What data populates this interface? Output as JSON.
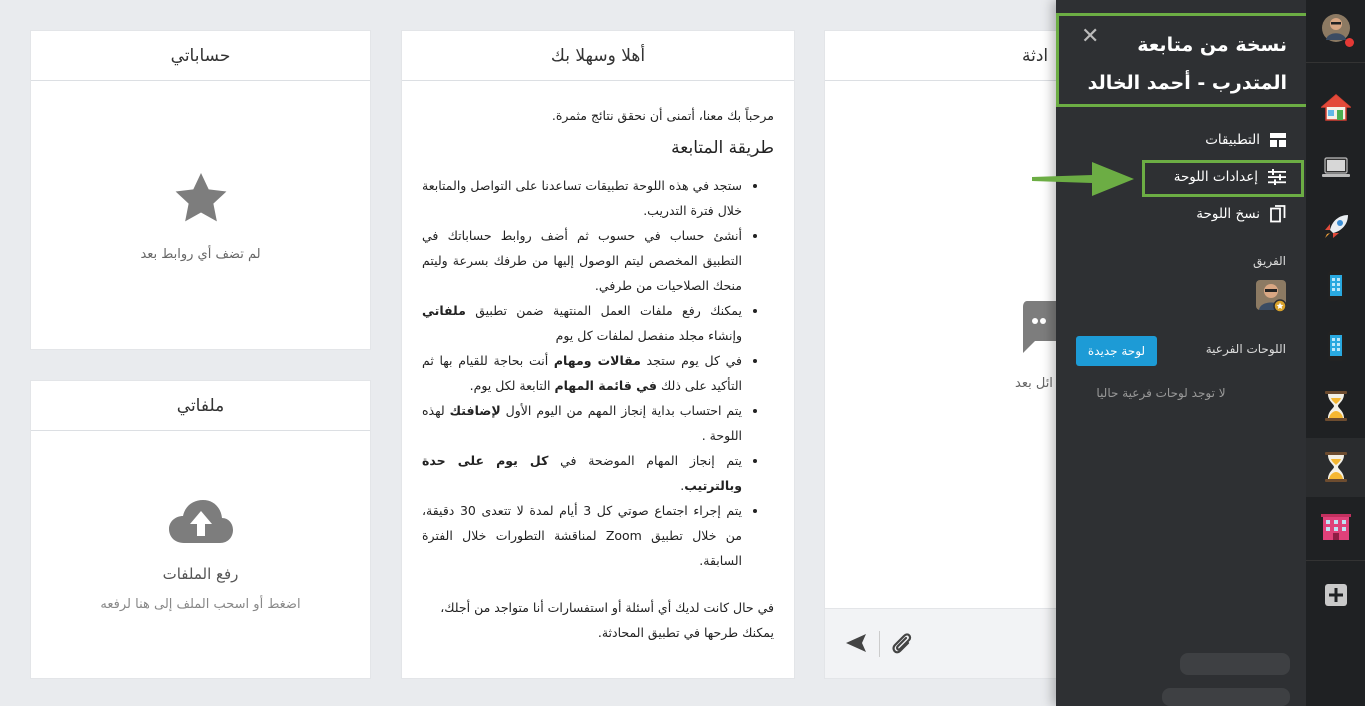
{
  "accounts_card": {
    "title": "حساباتي",
    "empty_text": "لم تضف أي روابط بعد"
  },
  "files_card": {
    "title": "ملفاتي",
    "upload_title": "رفع الملفات",
    "upload_hint": "اضغط أو اسحب الملف إلى هنا لرفعه"
  },
  "welcome_card": {
    "title": "أهلا وسهلا بك",
    "intro": "مرحباً بك معنا، أتمنى أن نحقق نتائج مثمرة.",
    "heading": "طريقة المتابعة",
    "items": [
      {
        "text": "ستجد في هذه اللوحة تطبيقات تساعدنا على التواصل والمتابعة خلال فترة التدريب."
      },
      {
        "text": "أنشئ حساب في حسوب ثم أضف روابط حساباتك في التطبيق المخصص ليتم الوصول إليها من طرفك بسرعة وليتم منحك الصلاحيات من طرفي."
      },
      {
        "pre": "يمكنك رفع ملفات العمل المنتهية ضمن تطبيق ",
        "bold": "ملفاتي",
        "post": " وإنشاء مجلد منفصل لملفات كل يوم"
      },
      {
        "pre": "في كل يوم ستجد ",
        "bold": "مقالات ومهام",
        "mid": " أنت بحاجة للقيام بها ثم التأكيد على ذلك ",
        "bold2": "في قائمة المهام",
        "post": " التابعة لكل يوم."
      },
      {
        "pre": "يتم احتساب بداية إنجاز المهم من اليوم الأول ",
        "bold": "لإضافتك",
        "post": " لهذه اللوحة ."
      },
      {
        "pre": "يتم إنجاز المهام الموضحة في ",
        "bold": "كل يوم على حدة وبالترتيب",
        "post": "."
      },
      {
        "text": "يتم إجراء اجتماع صوتي كل 3 أيام لمدة لا تتعدى 30 دقيقة، من خلال تطبيق Zoom لمناقشة التطورات خلال الفترة السابقة."
      }
    ],
    "outro": "في حال كانت لديك أي أسئلة أو استفسارات أنا متواجد من أجلك، يمكنك طرحها في تطبيق المحادثة."
  },
  "chat_card": {
    "title_partial": "ادثة",
    "empty_partial": "ائل بعد"
  },
  "side_panel": {
    "title_line1": "نسخة من متابعة",
    "title_line2": "المتدرب - أحمد الخالد",
    "close_icon": "close-icon",
    "menu": {
      "apps": "التطبيقات",
      "board_settings": "إعدادات اللوحة",
      "copy_board": "نسخ اللوحة"
    },
    "team_label": "الفريق",
    "subboards_label": "اللوحات الفرعية",
    "new_board_button": "لوحة جديدة",
    "no_subboards": "لا توجد لوحات فرعية حاليا"
  },
  "icon_rail": {
    "items": [
      "user-avatar",
      "home-icon",
      "laptop-icon",
      "rocket-icon",
      "phone-icon",
      "phone-icon",
      "hourglass-icon",
      "hourglass-icon",
      "building-icon",
      "add-icon"
    ],
    "active_item": "hourglass-icon"
  },
  "colors": {
    "highlight_green": "#6cad44",
    "panel_bg": "#2e3033",
    "rail_bg": "#1f2123",
    "button_blue": "#1d9bd6",
    "notification_red": "#e53935"
  }
}
